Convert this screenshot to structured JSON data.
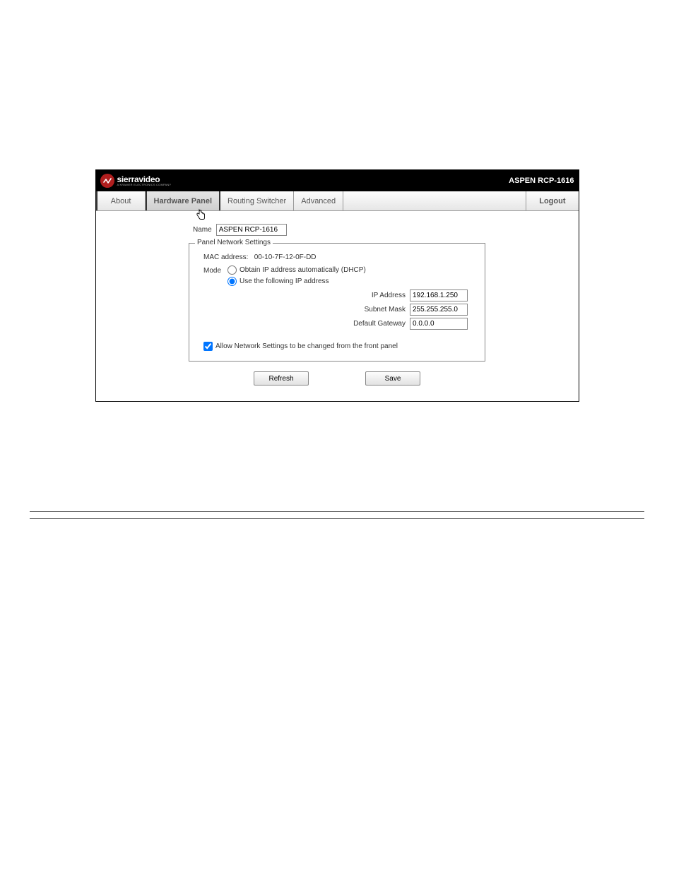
{
  "brand": {
    "main": "sierravideo",
    "sub": "A KRAMER ELECTRONICS COMPANY"
  },
  "product_name": "ASPEN RCP-1616",
  "tabs": [
    {
      "label": "About",
      "active": false
    },
    {
      "label": "Hardware Panel",
      "active": true
    },
    {
      "label": "Routing Switcher",
      "active": false
    },
    {
      "label": "Advanced",
      "active": false
    }
  ],
  "logout_label": "Logout",
  "form": {
    "name_label": "Name",
    "name_value": "ASPEN RCP-1616",
    "fieldset_legend": "Panel Network Settings",
    "mac_label": "MAC address:",
    "mac_value": "00-10-7F-12-0F-DD",
    "mode_label": "Mode",
    "radio_dhcp_label": "Obtain IP address automatically (DHCP)",
    "radio_static_label": "Use the following IP address",
    "ip_rows": {
      "ip_label": "IP Address",
      "ip_value": "192.168.1.250",
      "subnet_label": "Subnet Mask",
      "subnet_value": "255.255.255.0",
      "gateway_label": "Default Gateway",
      "gateway_value": "0.0.0.0"
    },
    "allow_front_panel_label": "Allow Network Settings to be changed from the front panel"
  },
  "buttons": {
    "refresh": "Refresh",
    "save": "Save"
  }
}
